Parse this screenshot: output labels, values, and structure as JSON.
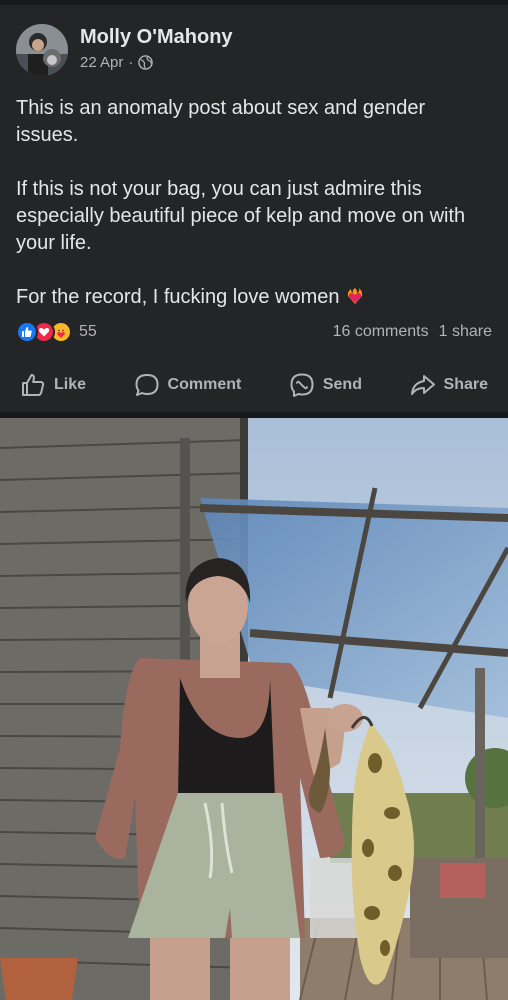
{
  "post": {
    "author": "Molly O'Mahony",
    "date": "22 Apr",
    "separator": "·",
    "privacy_icon": "globe-icon",
    "paragraphs": [
      "This is an anomaly post about sex and gender issues.",
      "If this is not your bag, you can just admire this especially beautiful piece of kelp and move on with your life.",
      "For the record, I fucking love women"
    ],
    "trailing_emoji": "burning-heart-emoji"
  },
  "reactions": {
    "icons": [
      "like-reaction-icon",
      "love-reaction-icon",
      "care-reaction-icon"
    ],
    "count": "55",
    "comments": "16 comments",
    "shares": "1 share"
  },
  "actions": {
    "like": "Like",
    "comment": "Comment",
    "send": "Send",
    "share": "Share"
  },
  "colors": {
    "background": "#242526",
    "text": "#e4e6eb",
    "secondary_text": "#b0b3b8",
    "like_blue": "#1877f2",
    "love_red": "#f02849",
    "care_yellow": "#f7b928"
  }
}
